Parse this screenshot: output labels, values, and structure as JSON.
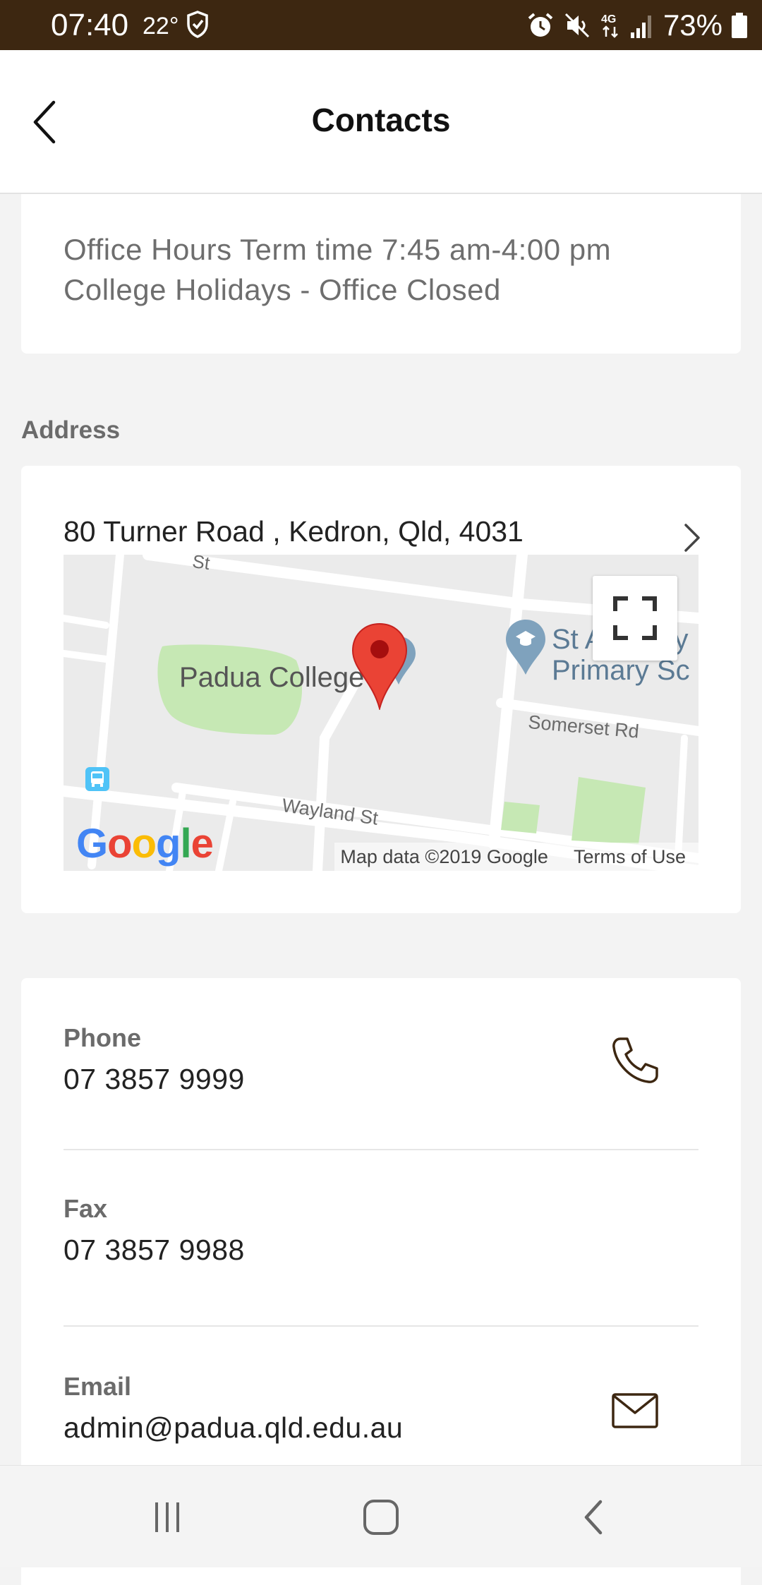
{
  "status_bar": {
    "time": "07:40",
    "temperature": "22°",
    "network": "4G",
    "battery": "73%",
    "background": "#3d2711"
  },
  "header": {
    "title": "Contacts",
    "back_icon": "chevron-left-icon"
  },
  "hours": {
    "text_line1": "Office Hours Term time 7:45 am-4:00 pm",
    "text_line2": "College Holidays - Office Closed"
  },
  "address": {
    "section_label": "Address",
    "text": "80 Turner Road , Kedron, Qld, 4031",
    "map": {
      "poi_school": "Padua College",
      "poi_other_line1": "St Anthony",
      "poi_other_line2": "Primary Sc",
      "street_1": "Somerset Rd",
      "street_2": "Wayland St",
      "street_3": "St",
      "google_logo": "Google",
      "attribution": "Map data ©2019 Google",
      "terms": "Terms of Use"
    }
  },
  "contacts": {
    "phone": {
      "label": "Phone",
      "value": "07 3857 9999",
      "icon": "phone-icon"
    },
    "fax": {
      "label": "Fax",
      "value": "07 3857 9988"
    },
    "email": {
      "label": "Email",
      "value": "admin@padua.qld.edu.au",
      "icon": "mail-icon"
    }
  },
  "accent_color": "#3d2711"
}
